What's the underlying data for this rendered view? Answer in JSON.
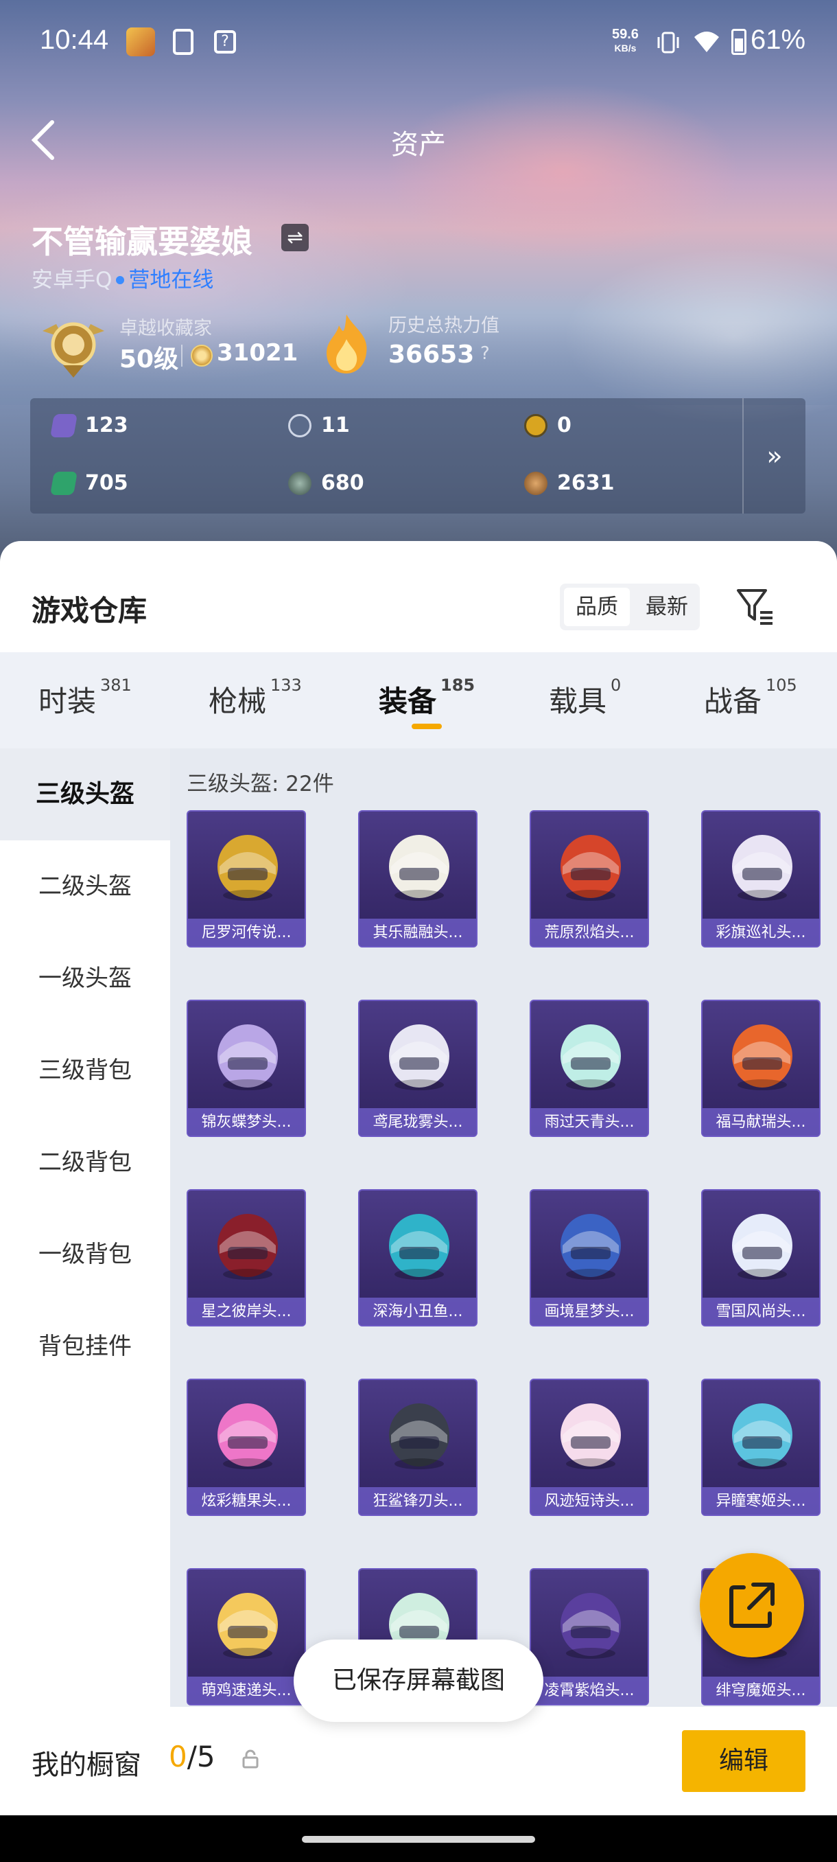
{
  "status_bar": {
    "time": "10:44",
    "net_speed_value": "59.6",
    "net_speed_unit": "KB/s",
    "battery": "61%"
  },
  "header": {
    "title": "资产",
    "back_icon": "chevron-left-icon"
  },
  "profile": {
    "name": "不管输赢要婆娘",
    "platform": "安卓手Q",
    "status": "营地在线",
    "collector_title": "卓越收藏家",
    "collector_level": "50级",
    "collector_points": "31021",
    "heat_label": "历史总热力值",
    "heat_value": "36653",
    "help": "?"
  },
  "resources": [
    {
      "icon": "card-purple-icon",
      "value": "123",
      "color": "#7a64c8"
    },
    {
      "icon": "s-coin-icon",
      "value": "11",
      "color": "#5b6b8a"
    },
    {
      "icon": "a-coin-icon",
      "value": "0",
      "color": "#d9a520"
    },
    {
      "icon": "card-green-icon",
      "value": "705",
      "color": "#2fa36b"
    },
    {
      "icon": "silver-coin-icon",
      "value": "680",
      "color": "#5f7a70"
    },
    {
      "icon": "bronze-coin-icon",
      "value": "2631",
      "color": "#b5773a"
    }
  ],
  "resources_more": "»",
  "warehouse": {
    "title": "游戏仓库",
    "sort_options": [
      "品质",
      "最新"
    ],
    "tabs": [
      {
        "label": "时装",
        "count": "381"
      },
      {
        "label": "枪械",
        "count": "133"
      },
      {
        "label": "装备",
        "count": "185"
      },
      {
        "label": "载具",
        "count": "0"
      },
      {
        "label": "战备",
        "count": "105"
      }
    ],
    "categories": [
      "三级头盔",
      "二级头盔",
      "一级头盔",
      "三级背包",
      "二级背包",
      "一级背包",
      "背包挂件"
    ],
    "count_label": "三级头盔: 22件",
    "items": [
      {
        "name": "尼罗河传说...",
        "color": "#d9a830"
      },
      {
        "name": "其乐融融头...",
        "color": "#f1efe6"
      },
      {
        "name": "荒原烈焰头...",
        "color": "#d6452a"
      },
      {
        "name": "彩旗巡礼头...",
        "color": "#e9e4f4"
      },
      {
        "name": "锦灰蝶梦头...",
        "color": "#b9a6e6"
      },
      {
        "name": "鸢尾珑雾头...",
        "color": "#e7e6f3"
      },
      {
        "name": "雨过天青头...",
        "color": "#bfeee6"
      },
      {
        "name": "福马献瑞头...",
        "color": "#e8662c"
      },
      {
        "name": "星之彼岸头...",
        "color": "#8a1f2b"
      },
      {
        "name": "深海小丑鱼...",
        "color": "#2fb3c9"
      },
      {
        "name": "画境星梦头...",
        "color": "#3b63c4"
      },
      {
        "name": "雪国风尚头...",
        "color": "#e6ecfa"
      },
      {
        "name": "炫彩糖果头...",
        "color": "#ee76c8"
      },
      {
        "name": "狂鲨锋刃头...",
        "color": "#3a3f4c"
      },
      {
        "name": "风迹短诗头...",
        "color": "#f6dcec"
      },
      {
        "name": "异瞳寒姬头...",
        "color": "#5cc4e0"
      },
      {
        "name": "萌鸡速递头...",
        "color": "#f4c95c"
      },
      {
        "name": "",
        "color": "#cfeee0"
      },
      {
        "name": "凌霄紫焰头...",
        "color": "#5a3f9e"
      },
      {
        "name": "绯穹魔姬头...",
        "color": "#c2354a"
      }
    ]
  },
  "toast": "已保存屏幕截图",
  "showcase": {
    "label": "我的橱窗",
    "current": "0",
    "total": "/5",
    "edit": "编辑"
  },
  "colors": {
    "accent": "#f5a800",
    "online": "#2f7fff"
  }
}
